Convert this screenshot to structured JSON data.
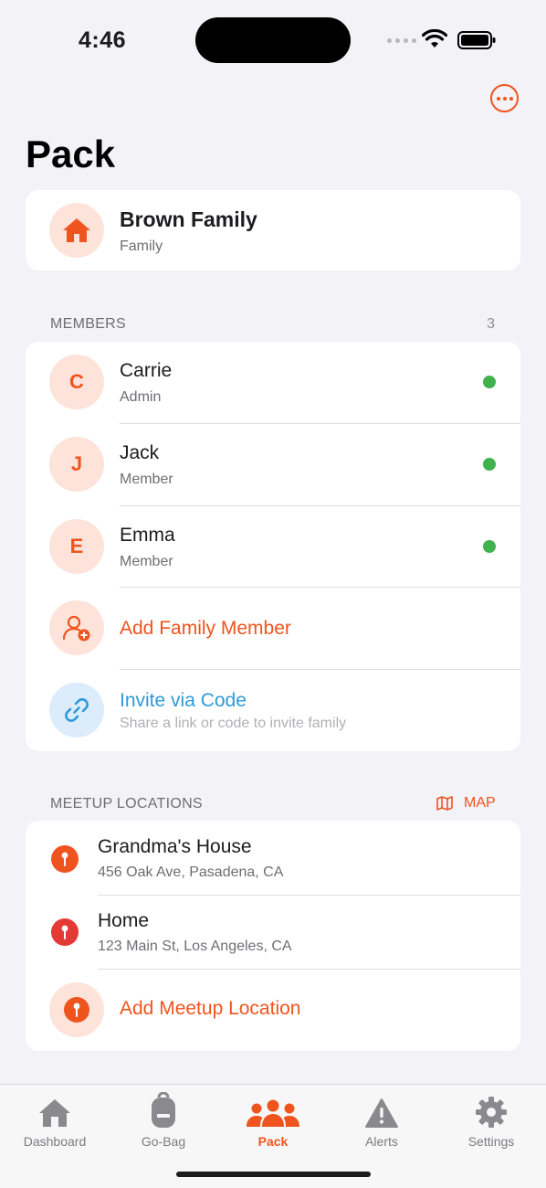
{
  "status_bar": {
    "time": "4:46"
  },
  "page": {
    "title": "Pack"
  },
  "family": {
    "name": "Brown Family",
    "type": "Family"
  },
  "members_section": {
    "header": "MEMBERS",
    "count": "3",
    "members": [
      {
        "initial": "C",
        "name": "Carrie",
        "role": "Admin",
        "status": "online"
      },
      {
        "initial": "J",
        "name": "Jack",
        "role": "Member",
        "status": "online"
      },
      {
        "initial": "E",
        "name": "Emma",
        "role": "Member",
        "status": "online"
      }
    ],
    "add_label": "Add Family Member",
    "invite": {
      "title": "Invite via Code",
      "subtitle": "Share a link or code to invite family"
    }
  },
  "meetup_section": {
    "header": "MEETUP LOCATIONS",
    "map_label": "MAP",
    "locations": [
      {
        "name": "Grandma's House",
        "address": "456 Oak Ave, Pasadena, CA",
        "color": "#f0541e"
      },
      {
        "name": "Home",
        "address": "123 Main St, Los Angeles, CA",
        "color": "#e53935"
      }
    ],
    "add_label": "Add Meetup Location"
  },
  "tabs": [
    {
      "label": "Dashboard",
      "icon": "house-icon",
      "active": false
    },
    {
      "label": "Go-Bag",
      "icon": "backpack-icon",
      "active": false
    },
    {
      "label": "Pack",
      "icon": "people-icon",
      "active": true
    },
    {
      "label": "Alerts",
      "icon": "warning-icon",
      "active": false
    },
    {
      "label": "Settings",
      "icon": "gear-icon",
      "active": false
    }
  ],
  "colors": {
    "accent": "#f0541e",
    "link": "#2d9ad9",
    "online": "#3fb24e",
    "background": "#f2f2f7"
  }
}
